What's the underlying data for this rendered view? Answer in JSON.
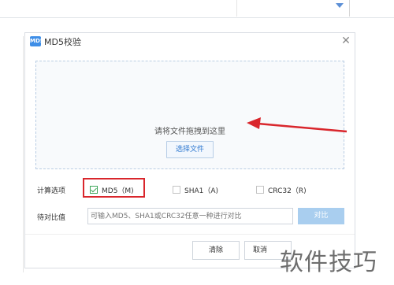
{
  "dialog": {
    "title": "MD5校验",
    "icon_text": "MD5",
    "close_icon": "close-icon"
  },
  "dropzone": {
    "hint": "请将文件拖拽到这里",
    "choose_button": "选择文件"
  },
  "options": {
    "label": "计算选项",
    "items": [
      {
        "label": "MD5（M)",
        "checked": true
      },
      {
        "label": "SHA1（A)",
        "checked": false
      },
      {
        "label": "CRC32（R)",
        "checked": false
      }
    ]
  },
  "compare": {
    "label": "待对比值",
    "placeholder": "可输入MD5、SHA1或CRC32任意一种进行对比",
    "button": "对比"
  },
  "footer": {
    "clear_button": "清除",
    "cancel_button": "取消"
  },
  "watermark": "软件技巧",
  "colors": {
    "accent": "#3e8ee7",
    "highlight": "#d9262c",
    "compare_button": "#a9ceef",
    "check": "#3ea65a"
  }
}
